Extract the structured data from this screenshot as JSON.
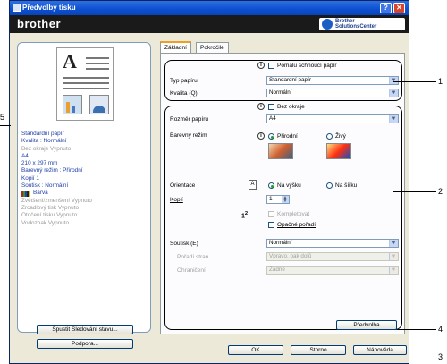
{
  "window": {
    "title": "Předvolby tisku",
    "help_glyph": "?",
    "close_glyph": "✕"
  },
  "brand": {
    "logo": "brother",
    "solutions_line1": "Brother",
    "solutions_line2": "SolutionsCenter"
  },
  "preview_panel": {
    "summary": [
      {
        "text": "Standardní papír",
        "style": "blue"
      },
      {
        "text": "Kvalita : Normální",
        "style": "blue"
      },
      {
        "text": "Bez okraje Vypnuto",
        "style": "grey"
      },
      {
        "text": "A4",
        "style": "blue"
      },
      {
        "text": "210 x 297 mm",
        "style": "blue"
      },
      {
        "text": "Barevný režim : Přirodní",
        "style": "blue"
      },
      {
        "text": "Kopií 1",
        "style": "blue"
      },
      {
        "text": "Soutisk : Normální",
        "style": "blue"
      }
    ],
    "color_label": "Barva",
    "summary_disabled": [
      "Zvětšení/zmenšení Vypnuto",
      "Zrcadlový tisk Vypnuto",
      "Otočení tisku Vypnuto",
      "Vodoznak Vypnuto"
    ],
    "status_button": "Spustit Sledování stavu...",
    "support_button": "Podpora..."
  },
  "tabs": [
    {
      "label": "Základní"
    },
    {
      "label": "Pokročilé"
    }
  ],
  "basic": {
    "slow_drying_label": "Pomalu schnoucí papír",
    "paper_type_label": "Typ papíru",
    "paper_type_value": "Standardní papír",
    "quality_label": "Kvalita (Q)",
    "quality_value": "Normální",
    "borderless_label": "Bez okraje",
    "paper_size_label": "Rozměr papíru",
    "paper_size_value": "A4",
    "color_mode_label": "Barevný režim",
    "natural_label": "Přirodní",
    "vivid_label": "Živý",
    "orientation_label": "Orientace",
    "portrait_label": "Na výšku",
    "landscape_label": "Na šířku",
    "copies_label": "Kopií",
    "copies_value": "1",
    "collate_label": "Kompletovat",
    "reverse_label": "Opačné pořadí",
    "multipage_label": "Soutisk (E)",
    "multipage_value": "Normální",
    "page_order_label": "Pořadí stran",
    "page_order_value": "Vpravo, pak dolů",
    "border_label": "Ohraničení",
    "border_value": "Žádné",
    "default_button": "Předvolba"
  },
  "dialog_buttons": {
    "ok": "OK",
    "cancel": "Storno",
    "help": "Nápověda"
  },
  "callouts": {
    "n1": "1",
    "n2": "2",
    "n3": "3",
    "n4": "4",
    "n5": "5"
  }
}
